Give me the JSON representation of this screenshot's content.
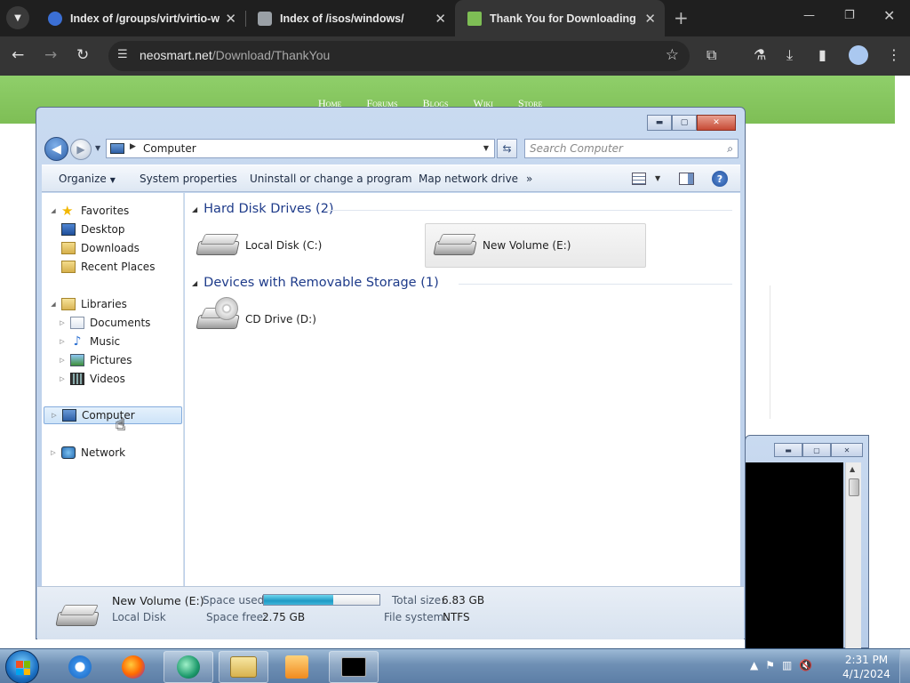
{
  "browser": {
    "tabs": [
      {
        "title": "Index of /groups/virt/virtio-wi",
        "active": false
      },
      {
        "title": "Index of /isos/windows/",
        "active": false
      },
      {
        "title": "Thank You for Downloading Ea",
        "active": true
      }
    ],
    "url_host": "neosmart.net",
    "url_path": "/Download/ThankYou"
  },
  "website": {
    "nav": [
      "Home",
      "Forums",
      "Blogs",
      "Wiki",
      "Store"
    ]
  },
  "explorer": {
    "address": "Computer",
    "search_placeholder": "Search Computer",
    "commands": {
      "organize": "Organize",
      "system_properties": "System properties",
      "uninstall": "Uninstall or change a program",
      "map_drive": "Map network drive",
      "more": "»"
    },
    "nav": {
      "favorites": "Favorites",
      "desktop": "Desktop",
      "downloads": "Downloads",
      "recent_places": "Recent Places",
      "libraries": "Libraries",
      "documents": "Documents",
      "music": "Music",
      "pictures": "Pictures",
      "videos": "Videos",
      "computer": "Computer",
      "network": "Network"
    },
    "groups": {
      "hard_disks": "Hard Disk Drives (2)",
      "removable": "Devices with Removable Storage (1)"
    },
    "drives": {
      "c": "Local Disk (C:)",
      "e": "New Volume (E:)",
      "d": "CD Drive (D:)"
    },
    "details": {
      "name": "New Volume (E:)",
      "type": "Local Disk",
      "space_used_label": "Space used:",
      "space_free_label": "Space free:",
      "space_free": "2.75 GB",
      "total_size_label": "Total size:",
      "total_size": "6.83 GB",
      "filesystem_label": "File system:",
      "filesystem": "NTFS",
      "used_fraction": 0.597
    }
  },
  "taskbar": {
    "time": "2:31 PM",
    "date": "4/1/2024"
  },
  "colors": {
    "explorer_group_heading": "#1e3b8a",
    "site_header_green": "#8fcf6a",
    "usage_bar": "#1e9ac4"
  }
}
